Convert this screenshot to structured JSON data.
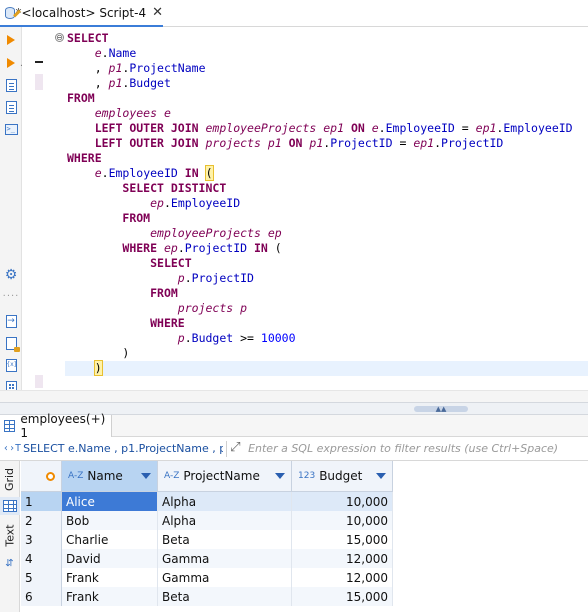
{
  "editor_tab": {
    "title": "*<localhost> Script-4",
    "close_glyph": "✕"
  },
  "sql": {
    "lines": [
      [
        {
          "t": "SELECT",
          "c": "kw"
        }
      ],
      [
        {
          "t": "    "
        },
        {
          "t": "e",
          "c": "al"
        },
        {
          "t": "."
        },
        {
          "t": "Name",
          "c": "fd"
        }
      ],
      [
        {
          "t": "    , "
        },
        {
          "t": "p1",
          "c": "al"
        },
        {
          "t": "."
        },
        {
          "t": "ProjectName",
          "c": "fd"
        }
      ],
      [
        {
          "t": "    , "
        },
        {
          "t": "p1",
          "c": "al"
        },
        {
          "t": "."
        },
        {
          "t": "Budget",
          "c": "fd"
        }
      ],
      [
        {
          "t": "FROM",
          "c": "kw"
        }
      ],
      [
        {
          "t": "    "
        },
        {
          "t": "employees",
          "c": "al"
        },
        {
          "t": " "
        },
        {
          "t": "e",
          "c": "al"
        }
      ],
      [
        {
          "t": "    "
        },
        {
          "t": "LEFT OUTER JOIN",
          "c": "kw"
        },
        {
          "t": " "
        },
        {
          "t": "employeeProjects",
          "c": "al"
        },
        {
          "t": " "
        },
        {
          "t": "ep1",
          "c": "al"
        },
        {
          "t": " "
        },
        {
          "t": "ON",
          "c": "kw"
        },
        {
          "t": " "
        },
        {
          "t": "e",
          "c": "al"
        },
        {
          "t": "."
        },
        {
          "t": "EmployeeID",
          "c": "fd"
        },
        {
          "t": " = "
        },
        {
          "t": "ep1",
          "c": "al"
        },
        {
          "t": "."
        },
        {
          "t": "EmployeeID",
          "c": "fd"
        }
      ],
      [
        {
          "t": "    "
        },
        {
          "t": "LEFT OUTER JOIN",
          "c": "kw"
        },
        {
          "t": " "
        },
        {
          "t": "projects",
          "c": "al"
        },
        {
          "t": " "
        },
        {
          "t": "p1",
          "c": "al"
        },
        {
          "t": " "
        },
        {
          "t": "ON",
          "c": "kw"
        },
        {
          "t": " "
        },
        {
          "t": "p1",
          "c": "al"
        },
        {
          "t": "."
        },
        {
          "t": "ProjectID",
          "c": "fd"
        },
        {
          "t": " = "
        },
        {
          "t": "ep1",
          "c": "al"
        },
        {
          "t": "."
        },
        {
          "t": "ProjectID",
          "c": "fd"
        }
      ],
      [
        {
          "t": "WHERE",
          "c": "kw"
        }
      ],
      [
        {
          "t": "    "
        },
        {
          "t": "e",
          "c": "al"
        },
        {
          "t": "."
        },
        {
          "t": "EmployeeID",
          "c": "fd"
        },
        {
          "t": " "
        },
        {
          "t": "IN",
          "c": "kw"
        },
        {
          "t": " "
        },
        {
          "t": "(",
          "c": "paren-hl"
        }
      ],
      [
        {
          "t": "        "
        },
        {
          "t": "SELECT DISTINCT",
          "c": "kw"
        }
      ],
      [
        {
          "t": "            "
        },
        {
          "t": "ep",
          "c": "al"
        },
        {
          "t": "."
        },
        {
          "t": "EmployeeID",
          "c": "fd"
        }
      ],
      [
        {
          "t": "        "
        },
        {
          "t": "FROM",
          "c": "kw"
        }
      ],
      [
        {
          "t": "            "
        },
        {
          "t": "employeeProjects",
          "c": "al"
        },
        {
          "t": " "
        },
        {
          "t": "ep",
          "c": "al"
        }
      ],
      [
        {
          "t": "        "
        },
        {
          "t": "WHERE",
          "c": "kw"
        },
        {
          "t": " "
        },
        {
          "t": "ep",
          "c": "al"
        },
        {
          "t": "."
        },
        {
          "t": "ProjectID",
          "c": "fd"
        },
        {
          "t": " "
        },
        {
          "t": "IN",
          "c": "kw"
        },
        {
          "t": " ("
        }
      ],
      [
        {
          "t": "            "
        },
        {
          "t": "SELECT",
          "c": "kw"
        }
      ],
      [
        {
          "t": "                "
        },
        {
          "t": "p",
          "c": "al"
        },
        {
          "t": "."
        },
        {
          "t": "ProjectID",
          "c": "fd"
        }
      ],
      [
        {
          "t": "            "
        },
        {
          "t": "FROM",
          "c": "kw"
        }
      ],
      [
        {
          "t": "                "
        },
        {
          "t": "projects",
          "c": "al"
        },
        {
          "t": " "
        },
        {
          "t": "p",
          "c": "al"
        }
      ],
      [
        {
          "t": "            "
        },
        {
          "t": "WHERE",
          "c": "kw"
        }
      ],
      [
        {
          "t": "                "
        },
        {
          "t": "p",
          "c": "al"
        },
        {
          "t": "."
        },
        {
          "t": "Budget",
          "c": "fd"
        },
        {
          "t": " >= "
        },
        {
          "t": "10000",
          "c": "num"
        }
      ],
      [
        {
          "t": "        )"
        }
      ],
      [
        {
          "t": "    "
        },
        {
          "t": ")",
          "c": "paren-hl"
        },
        {
          "t": "",
          "c": "caret"
        }
      ]
    ],
    "current_line_index": 22
  },
  "fold_glyph": "⊖",
  "results_tab": {
    "title": "employees(+) 1"
  },
  "filter": {
    "sql_icon": "‹›T",
    "sql_text": "SELECT e.Name , p1.ProjectName , p",
    "placeholder": "Enter a SQL expression to filter results (use Ctrl+Space)"
  },
  "side_tabs": {
    "grid": "Grid",
    "text": "Text"
  },
  "grid": {
    "columns": [
      {
        "type_badge": "A-Z",
        "label": "Name"
      },
      {
        "type_badge": "A-Z",
        "label": "ProjectName"
      },
      {
        "type_badge": "123",
        "label": "Budget"
      }
    ],
    "rows": [
      {
        "num": "1",
        "name": "Alice",
        "project": "Alpha",
        "budget": "10,000"
      },
      {
        "num": "2",
        "name": "Bob",
        "project": "Alpha",
        "budget": "10,000"
      },
      {
        "num": "3",
        "name": "Charlie",
        "project": "Beta",
        "budget": "15,000"
      },
      {
        "num": "4",
        "name": "David",
        "project": "Gamma",
        "budget": "12,000"
      },
      {
        "num": "5",
        "name": "Frank",
        "project": "Gamma",
        "budget": "12,000"
      },
      {
        "num": "6",
        "name": "Frank",
        "project": "Beta",
        "budget": "15,000"
      }
    ],
    "selected_row_index": 0
  },
  "icons": {
    "tab": "script-edit-icon",
    "execute": "execute-statement-icon",
    "execute_new_tab": "execute-new-tab-icon",
    "explain": "explain-plan-icon",
    "load_script": "load-script-icon",
    "output": "output-console-icon",
    "settings": "gear-icon",
    "export": "export-icon",
    "lock": "lock-icon",
    "params": "parameters-icon",
    "outline": "outline-icon",
    "results": "grid-icon"
  },
  "colors": {
    "keyword": "#7f0055",
    "field": "#0000c0",
    "number": "#0000ff",
    "selection": "#3d7ad6",
    "accent": "#3b7dd8"
  }
}
